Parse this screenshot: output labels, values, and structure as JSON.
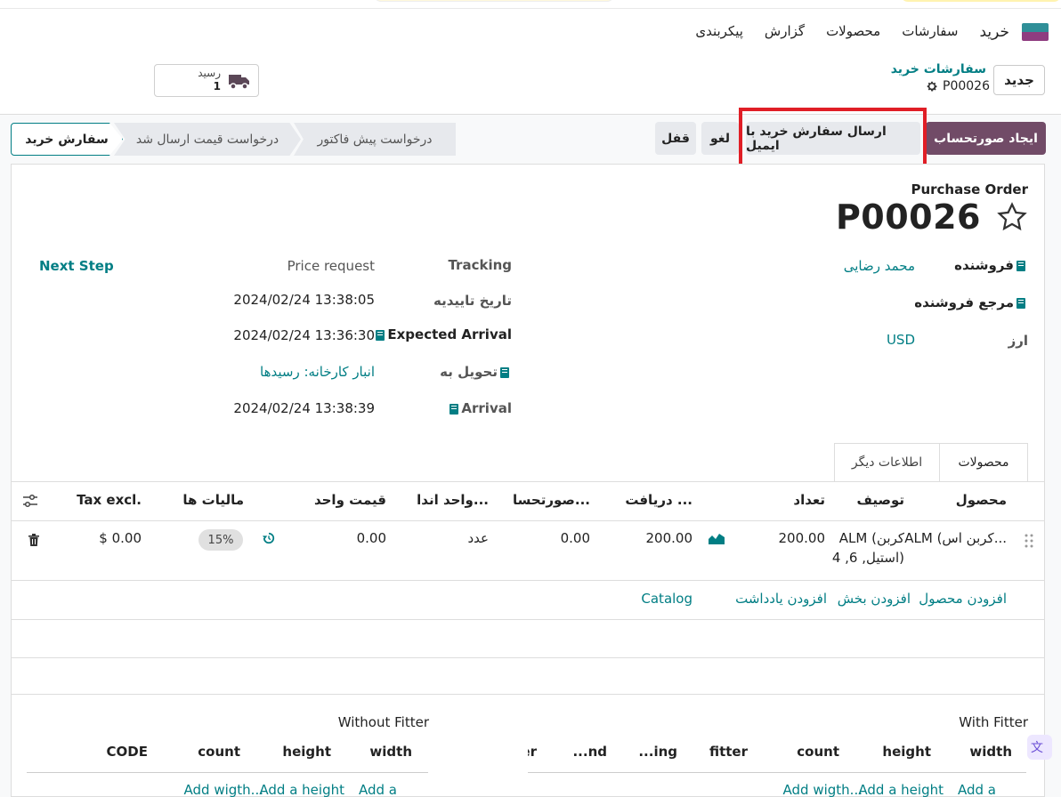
{
  "nav": {
    "brand": "خرید",
    "items": [
      "سفارشات",
      "محصولات",
      "گزارش",
      "پیکربندی"
    ]
  },
  "breadcrumb": {
    "new_label": "جدید",
    "parent": "سفارشات خرید",
    "record": "P00026"
  },
  "receipt": {
    "label": "رسید",
    "count": "1"
  },
  "actions": {
    "create_bill": "ایجاد صورتحساب",
    "send_email": "ارسال سفارش خرید با ایمیل",
    "cancel": "لغو",
    "lock": "قفل"
  },
  "statusbar": {
    "done": "سفارش خرید",
    "rfq_sent": "درخواست قیمت ارسال شد",
    "draft": "درخواست پیش فاکتور"
  },
  "sheet": {
    "type_label": "Purchase Order",
    "number": "P00026"
  },
  "fields": {
    "vendor_label": "فروشنده",
    "vendor_value": "محمد رضایی",
    "vendor_ref_label": "مرجع فروشنده",
    "currency_label": "ارز",
    "currency_value": "USD",
    "tracking_label": "Tracking",
    "tracking_value": "Price request",
    "next_step": "Next Step",
    "confirm_label": "تاریخ تاییدیه",
    "confirm_value": "2024/02/24 13:38:05",
    "expected_label": "Expected Arrival",
    "expected_value": "2024/02/24 13:36:30",
    "deliver_label": "تحویل به",
    "deliver_value": "انبار کارخانه: رسیدها",
    "arrival_label": "Arrival",
    "arrival_value": "2024/02/24 13:38:39"
  },
  "tabs": {
    "products": "محصولات",
    "other": "اطلاعات دیگر"
  },
  "table": {
    "headers": {
      "product": "محصول",
      "description": "توصیف",
      "qty": "تعداد",
      "received": "دریافت ...",
      "billed": "صورتحسا...",
      "uom": "واحد اندا...",
      "price": "قیمت واحد",
      "taxes": "مالیات ها",
      "subtotal": "Tax excl."
    },
    "row": {
      "product": "ALM (کربن اس...",
      "description_line1": "ALM (کربن",
      "description_line2": "استیل, 6, 4)",
      "qty": "200.00",
      "received": "200.00",
      "billed": "0.00",
      "uom": "عدد",
      "price": "0.00",
      "tax": "15%",
      "subtotal": "$ 0.00"
    },
    "add_product": "افزودن محصول",
    "add_section": "افزودن بخش",
    "add_note": "افزودن یادداشت",
    "catalog": "Catalog"
  },
  "fitter": {
    "with_title": "With Fitter",
    "without_title": "Without Fitter",
    "with_headers": [
      "width",
      "height",
      "count",
      "fitter",
      "...ing",
      "...nd",
      "...er"
    ],
    "without_headers": [
      "width",
      "height",
      "count",
      "CODE"
    ],
    "with_links": [
      "Add a",
      "Add a height",
      "Add wigth..."
    ],
    "without_links": [
      "Add a",
      "Add a height",
      "Add wigth..."
    ]
  }
}
